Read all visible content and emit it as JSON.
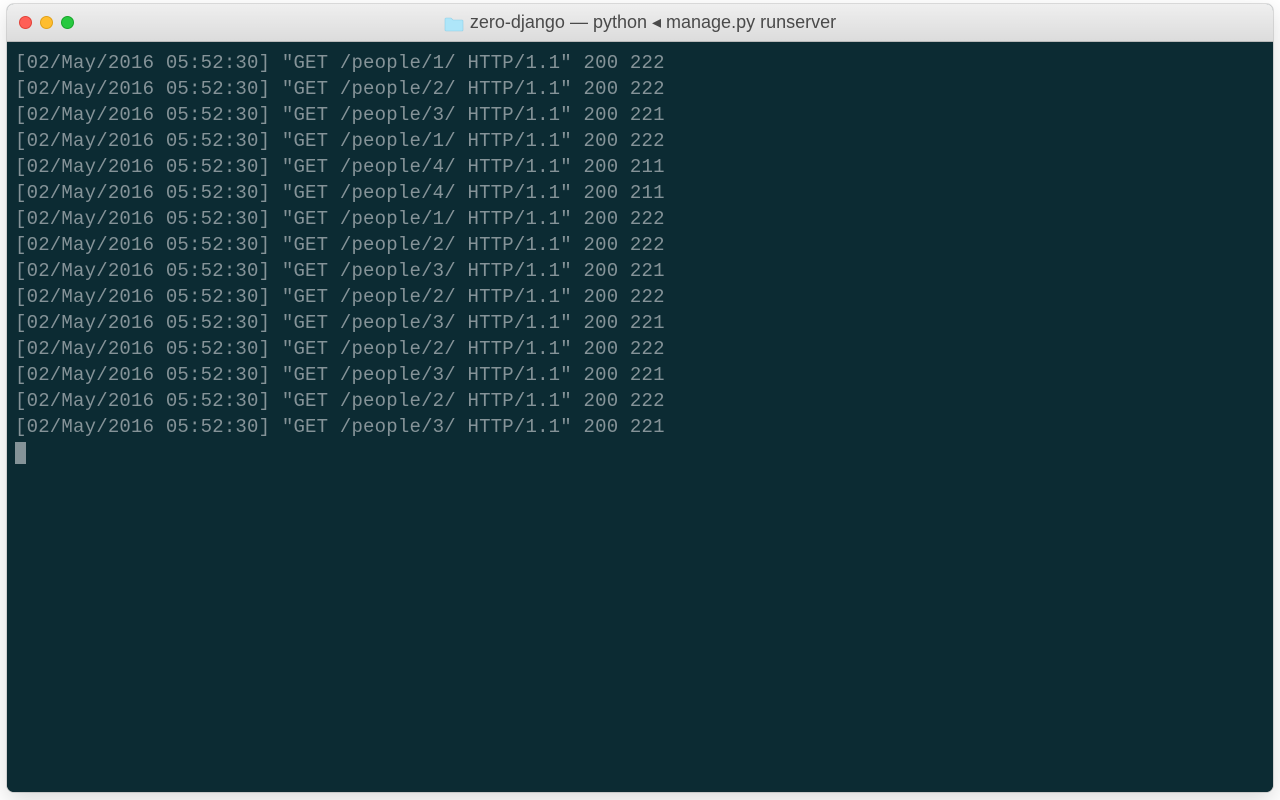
{
  "titlebar": {
    "title": "zero-django — python ◂ manage.py runserver"
  },
  "log_lines": [
    "[02/May/2016 05:52:30] \"GET /people/1/ HTTP/1.1\" 200 222",
    "[02/May/2016 05:52:30] \"GET /people/2/ HTTP/1.1\" 200 222",
    "[02/May/2016 05:52:30] \"GET /people/3/ HTTP/1.1\" 200 221",
    "[02/May/2016 05:52:30] \"GET /people/1/ HTTP/1.1\" 200 222",
    "[02/May/2016 05:52:30] \"GET /people/4/ HTTP/1.1\" 200 211",
    "[02/May/2016 05:52:30] \"GET /people/4/ HTTP/1.1\" 200 211",
    "[02/May/2016 05:52:30] \"GET /people/1/ HTTP/1.1\" 200 222",
    "[02/May/2016 05:52:30] \"GET /people/2/ HTTP/1.1\" 200 222",
    "[02/May/2016 05:52:30] \"GET /people/3/ HTTP/1.1\" 200 221",
    "[02/May/2016 05:52:30] \"GET /people/2/ HTTP/1.1\" 200 222",
    "[02/May/2016 05:52:30] \"GET /people/3/ HTTP/1.1\" 200 221",
    "[02/May/2016 05:52:30] \"GET /people/2/ HTTP/1.1\" 200 222",
    "[02/May/2016 05:52:30] \"GET /people/3/ HTTP/1.1\" 200 221",
    "[02/May/2016 05:52:30] \"GET /people/2/ HTTP/1.1\" 200 222",
    "[02/May/2016 05:52:30] \"GET /people/3/ HTTP/1.1\" 200 221"
  ]
}
